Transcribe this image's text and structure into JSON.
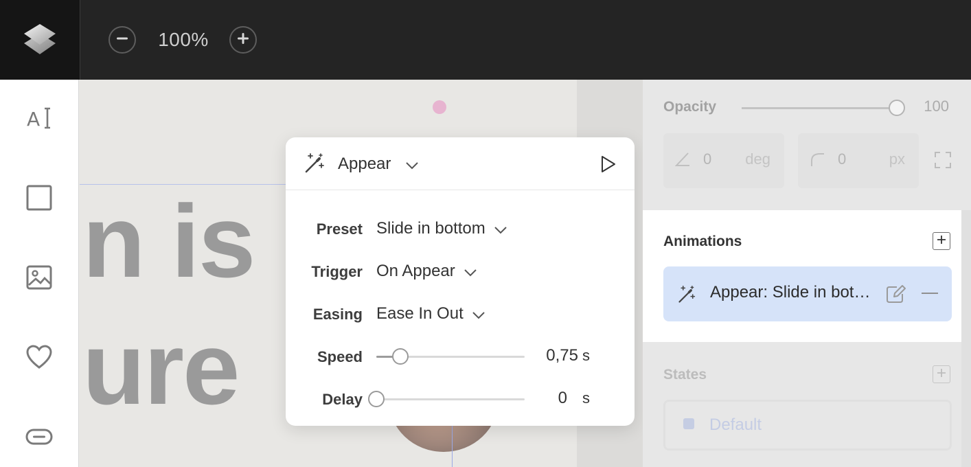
{
  "topbar": {
    "zoom_value": "100%",
    "logo_icon": "layers-logo-icon",
    "zoom_out_icon": "minus-circle-icon",
    "zoom_in_icon": "plus-circle-icon"
  },
  "toolbar": {
    "tools": [
      {
        "name": "text-tool",
        "icon": "text-cursor-icon"
      },
      {
        "name": "rectangle-tool",
        "icon": "square-icon"
      },
      {
        "name": "image-tool",
        "icon": "image-icon"
      },
      {
        "name": "icon-tool",
        "icon": "heart-icon"
      },
      {
        "name": "button-tool",
        "icon": "button-shape-icon"
      }
    ]
  },
  "canvas": {
    "line1": "n is",
    "line2": "ure"
  },
  "popover": {
    "title": "Appear",
    "properties": {
      "preset": {
        "label": "Preset",
        "value": "Slide in bottom"
      },
      "trigger": {
        "label": "Trigger",
        "value": "On Appear"
      },
      "easing": {
        "label": "Easing",
        "value": "Ease In Out"
      },
      "speed": {
        "label": "Speed",
        "value": "0,75",
        "unit": "s",
        "fraction": 0.16
      },
      "delay": {
        "label": "Delay",
        "value": "0",
        "unit": "s",
        "fraction": 0.0
      }
    }
  },
  "panel": {
    "opacity": {
      "label": "Opacity",
      "value": "100"
    },
    "rotation": {
      "value": "0",
      "unit": "deg"
    },
    "radius": {
      "value": "0",
      "unit": "px"
    },
    "animations": {
      "title": "Animations",
      "items": [
        {
          "label": "Appear: Slide in bottom"
        }
      ]
    },
    "states": {
      "title": "States",
      "items": [
        {
          "label": "Default"
        }
      ]
    }
  },
  "colors": {
    "topbar": "#242424",
    "accent_selection": "#d6e3f9",
    "canvas_text": "#9a9a9a",
    "state_accent": "#aab8e0"
  }
}
